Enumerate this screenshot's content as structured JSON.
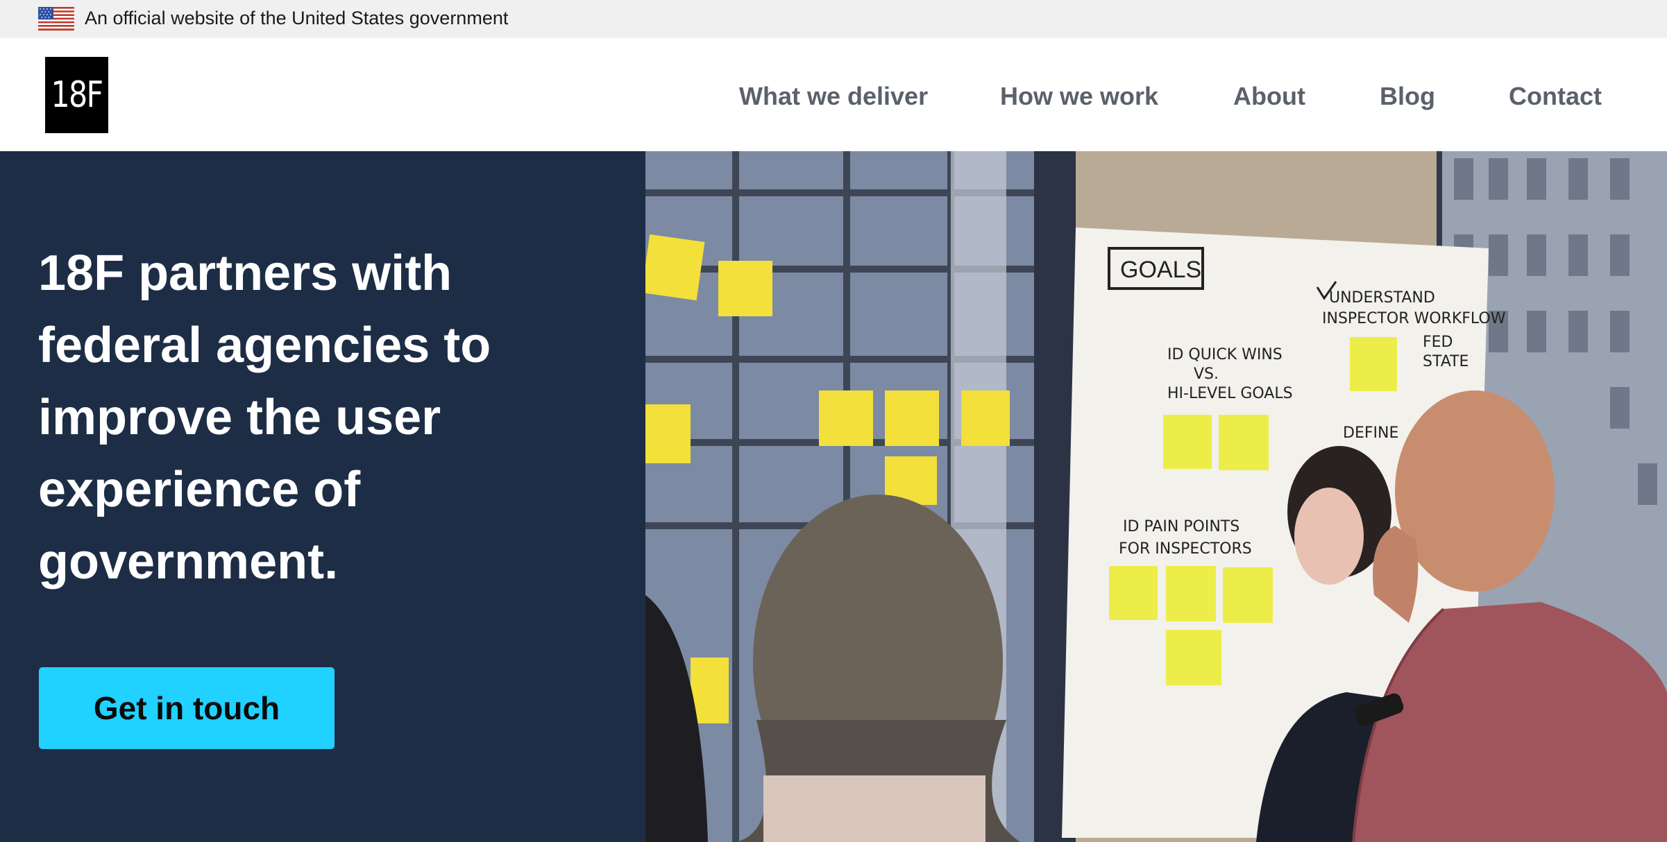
{
  "banner": {
    "text": "An official website of the United States government",
    "flag_icon": "us-flag-icon"
  },
  "header": {
    "logo_text": "18F",
    "nav": [
      {
        "label": "What we deliver"
      },
      {
        "label": "How we work"
      },
      {
        "label": "About"
      },
      {
        "label": "Blog"
      },
      {
        "label": "Contact"
      }
    ]
  },
  "hero": {
    "headline": "18F partners with federal agencies to improve the user experience of government.",
    "cta_label": "Get in touch",
    "photo": {
      "whiteboard_heading": "GOALS",
      "whiteboard_notes": [
        "UNDERSTAND",
        "INSPECTOR WORKFLOW",
        "FED",
        "STATE",
        "ID QUICK WINS",
        "VS.",
        "HI-LEVEL GOALS",
        "DEFINE",
        "ID PAIN POINTS",
        "FOR INSPECTORS"
      ]
    }
  },
  "colors": {
    "banner_bg": "#f0f0f0",
    "hero_bg": "#1d2d46",
    "cta_bg": "#21d1ff",
    "nav_text": "#5b616b"
  }
}
